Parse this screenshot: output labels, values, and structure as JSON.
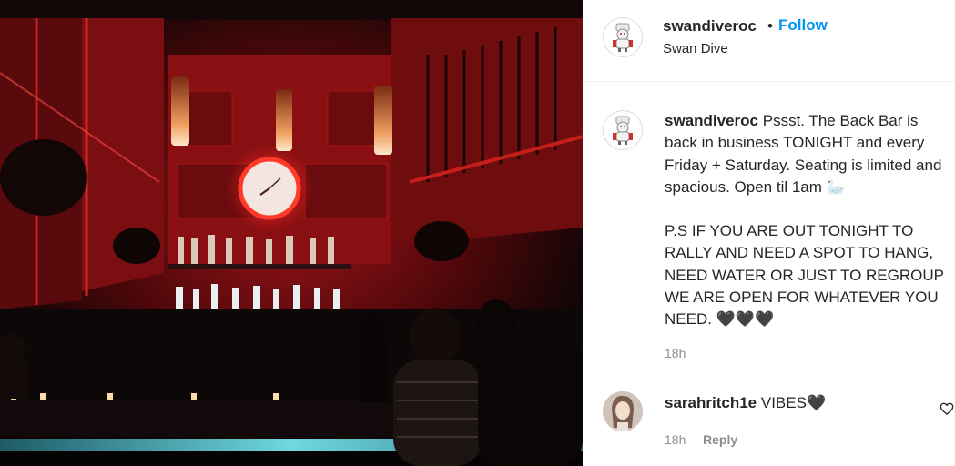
{
  "post": {
    "username": "swandiveroc",
    "follow_label": "Follow",
    "location": "Swan Dive",
    "separator": "•"
  },
  "caption": {
    "username": "swandiveroc",
    "text_1": "Pssst. The Back Bar is back in business TONIGHT and every Friday + Saturday. Seating is limited and spacious. Open til 1am 🦢",
    "text_2": "P.S IF YOU ARE OUT TONIGHT TO RALLY AND NEED A SPOT TO HANG, NEED WATER OR JUST TO REGROUP WE ARE OPEN FOR WHATEVER YOU NEED. 🖤🖤🖤",
    "time": "18h"
  },
  "comments": [
    {
      "username": "sarahritch1e",
      "text": "VIBES🖤",
      "time": "18h",
      "reply_label": "Reply"
    }
  ],
  "icons": {
    "avatar": "chef-mascot-icon",
    "like": "heart-outline-icon"
  },
  "colors": {
    "follow": "#0095f6",
    "muted": "#8e8e8e",
    "text": "#262626",
    "bar_neon": "#e0201c",
    "counter_glow": "#58c8d0"
  }
}
